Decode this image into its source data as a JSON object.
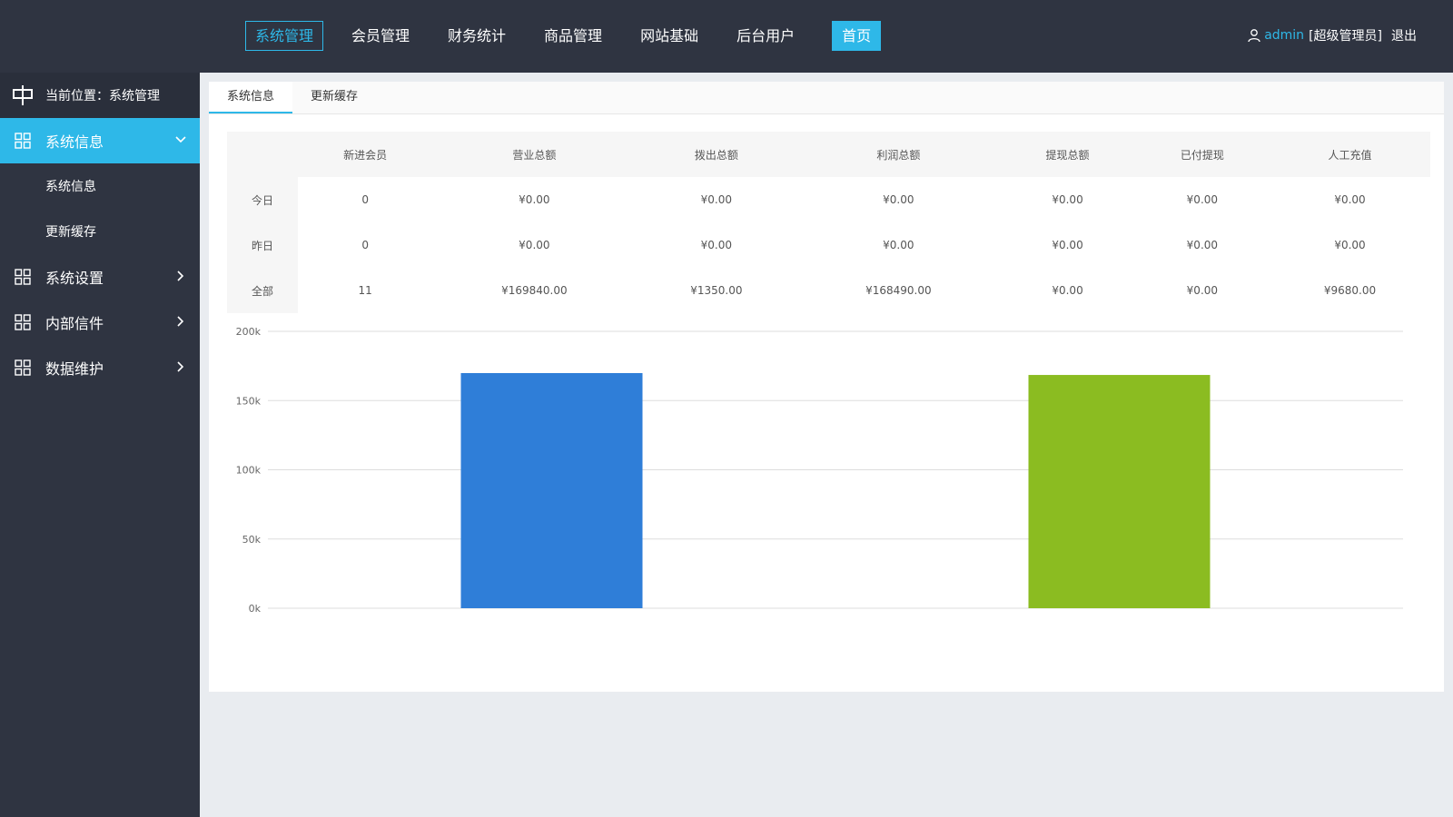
{
  "nav": {
    "items": [
      "系统管理",
      "会员管理",
      "财务统计",
      "商品管理",
      "网站基础",
      "后台用户"
    ],
    "home": "首页"
  },
  "user": {
    "name": "admin",
    "role": "[超级管理员]",
    "logout": "退出"
  },
  "sidebar": {
    "location": "当前位置：系统管理",
    "active_menu": "系统信息",
    "sub_items": [
      "系统信息",
      "更新缓存"
    ],
    "menus": [
      "系统设置",
      "内部信件",
      "数据维护"
    ]
  },
  "tabs": [
    "系统信息",
    "更新缓存"
  ],
  "stats": {
    "headers": [
      "",
      "新进会员",
      "营业总额",
      "拨出总额",
      "利润总额",
      "提现总额",
      "已付提现",
      "人工充值"
    ],
    "rows": [
      [
        "今日",
        "0",
        "¥0.00",
        "¥0.00",
        "¥0.00",
        "¥0.00",
        "¥0.00",
        "¥0.00"
      ],
      [
        "昨日",
        "0",
        "¥0.00",
        "¥0.00",
        "¥0.00",
        "¥0.00",
        "¥0.00",
        "¥0.00"
      ],
      [
        "全部",
        "11",
        "¥169840.00",
        "¥1350.00",
        "¥168490.00",
        "¥0.00",
        "¥0.00",
        "¥9680.00"
      ]
    ]
  },
  "chart_data": {
    "type": "bar",
    "yticks": [
      "0k",
      "50k",
      "100k",
      "150k",
      "200k"
    ],
    "ylim": [
      0,
      200000
    ],
    "values": [
      169840,
      168490
    ],
    "colors": [
      "#2f7ed8",
      "#8bbc21"
    ],
    "grid": true
  },
  "colors": {
    "accent": "#2eb8e8",
    "dark": "#2f3441"
  }
}
